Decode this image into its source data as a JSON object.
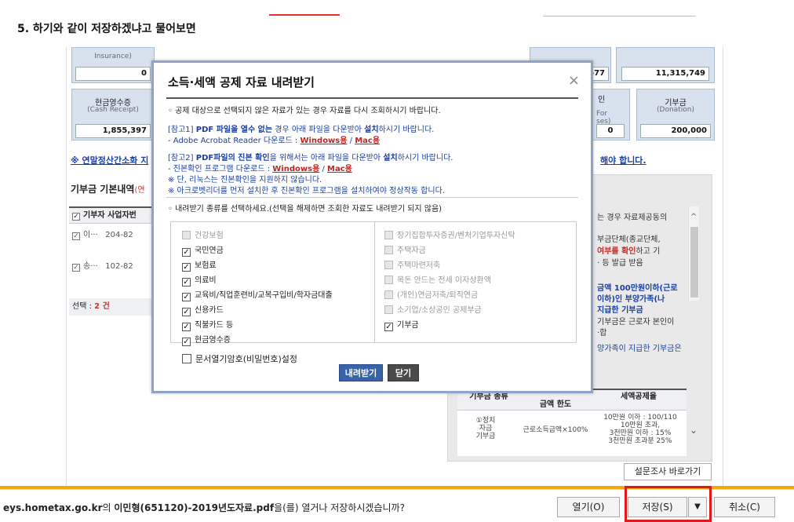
{
  "heading": "5. 하기와 같이 저장하겠냐고 물어보면",
  "bg": {
    "cell_top_left_label": "Insurance)",
    "val_top_left": "0",
    "val_top_mid": "677",
    "val_top_right": "11,315,749",
    "cash_label": "현금영수증",
    "cash_sub": "(Cash Receipt)",
    "cash_value": "1,855,397",
    "partial_label_1": "인",
    "partial_sub_1": "For",
    "partial_sub_2": "ses)",
    "partial_value": "0",
    "donation_label": "기부금",
    "donation_sub": "(Donation)",
    "donation_value": "200,000",
    "notice_link": "※ 연말정산간소화 지",
    "notice_link_tail": "해야 합니다.",
    "section_title": "기부금 기본내역",
    "section_title_tail": "(연",
    "table_head": "기부자 사업자번",
    "rows": [
      {
        "name": "이···",
        "num": "204-82"
      },
      {
        "name": "송···",
        "num": "102-82"
      }
    ],
    "selected_label": "선택 : ",
    "selected_count": "2 건",
    "rp_lines": [
      "는 경우 자료제공동의",
      "부금단체(종교단체,"
    ],
    "rp_red": "여부를 확인",
    "rp_red_tail": "하고 기",
    "rp_line3": "· 등 발급 받음",
    "rp_blue_lines": [
      "금액 100만원이하(근로",
      " 이하)인 부양가족(나",
      "지급한 기부금"
    ],
    "rp_lines2": [
      "기부금은 근로자 본인이",
      "·합"
    ],
    "rp_blue_last": "양가족이 지급한 기부금은",
    "rp_th1": "기부금 종류",
    "rp_th2": "금액 한도",
    "rp_th3": "세액공제율",
    "rp_td1": "①정치\n자금\n기부금",
    "rp_td2": "근로소득금액×100%",
    "rp_td3": "10만원 이하 : 100/110\n10만원 초과,\n3천만원 이하 : 15%\n3천만원 초과분 25%",
    "survey_btn": "설문조사 바로가기"
  },
  "modal": {
    "title": "소득·세액 공제 자료 내려받기",
    "close": "×",
    "line1": "◦ 공제 대상으로 선택되지 않은 자료가 있는 경우 자료를 다시 조회하시기 바랍니다.",
    "ref1_a": "[참고1] ",
    "ref1_b": "PDF 파일을 열수 없는",
    "ref1_c": " 경우  아래 파일을 다운받아 ",
    "ref1_d": "설치",
    "ref1_e": "하시기 바랍니다.",
    "ref1_line2": "- Adobe Acrobat Reader 다운로드 : ",
    "win_label": "Windows용",
    "slash": " / ",
    "mac_label": "Mac용",
    "ref2_a": "[참고2] ",
    "ref2_b": "PDF파일의 진본 확인",
    "ref2_c": "을 위해서는 아래 파일을 다운받아 ",
    "ref2_d": "설치",
    "ref2_e": "하시기 바랍니다.",
    "ref2_line2": "- 진본확인 프로그램 다운로드 : ",
    "ref2_line3": "※ 단, 리눅스는 진본확인을 지원하지 않습니다.",
    "ref2_line4": "※ 아크로벳리더를 먼저 설치한 후 진본확인 프로그램을 설치하여야 정상작동 합니다.",
    "select_guide": "◦ 내려받기 종류를 선택하세요.(선택을 해제하면 조회한 자료도 내려받기 되지 않음)",
    "left_options": [
      {
        "label": "건강보험",
        "checked": false,
        "disabled": true
      },
      {
        "label": "국민연금",
        "checked": true,
        "disabled": false
      },
      {
        "label": "보험료",
        "checked": true,
        "disabled": false
      },
      {
        "label": "의료비",
        "checked": true,
        "disabled": false
      },
      {
        "label": "교육비/직업훈련비/교복구입비/학자금대출",
        "checked": true,
        "disabled": false
      },
      {
        "label": "신용카드",
        "checked": true,
        "disabled": false
      },
      {
        "label": "직불카드 등",
        "checked": true,
        "disabled": false
      },
      {
        "label": "현금영수증",
        "checked": true,
        "disabled": false
      }
    ],
    "right_options": [
      {
        "label": "장기집합투자증권/벤처기업투자신탁",
        "checked": false,
        "disabled": true
      },
      {
        "label": "주택자금",
        "checked": false,
        "disabled": true
      },
      {
        "label": "주택마련저축",
        "checked": false,
        "disabled": true
      },
      {
        "label": "목돈 안드는 전세 이자상환액",
        "checked": false,
        "disabled": true
      },
      {
        "label": "(개인)연금저축/퇴직연금",
        "checked": false,
        "disabled": true
      },
      {
        "label": "소기업/소상공인 공제부금",
        "checked": false,
        "disabled": true
      },
      {
        "label": "기부금",
        "checked": true,
        "disabled": false
      }
    ],
    "password_label": "문서열기암호(비밀번호)설정",
    "download_btn": "내려받기",
    "close_btn": "닫기"
  },
  "downloadbar": {
    "domain": "eys.hometax.go.kr",
    "text_mid": "의 ",
    "filename": "이민형(651120)-2019년도자료.pdf",
    "text_tail": "을(를) 열거나 저장하시겠습니까?",
    "open_btn": "열기(O)",
    "save_btn": "저장(S)",
    "caret": "▼",
    "cancel_btn": "취소(C)"
  },
  "colors": {
    "highlight": "#e01a1a",
    "link_red": "#c0241e",
    "blue": "#1a3fa0",
    "download_btn": "#3a62a8"
  }
}
